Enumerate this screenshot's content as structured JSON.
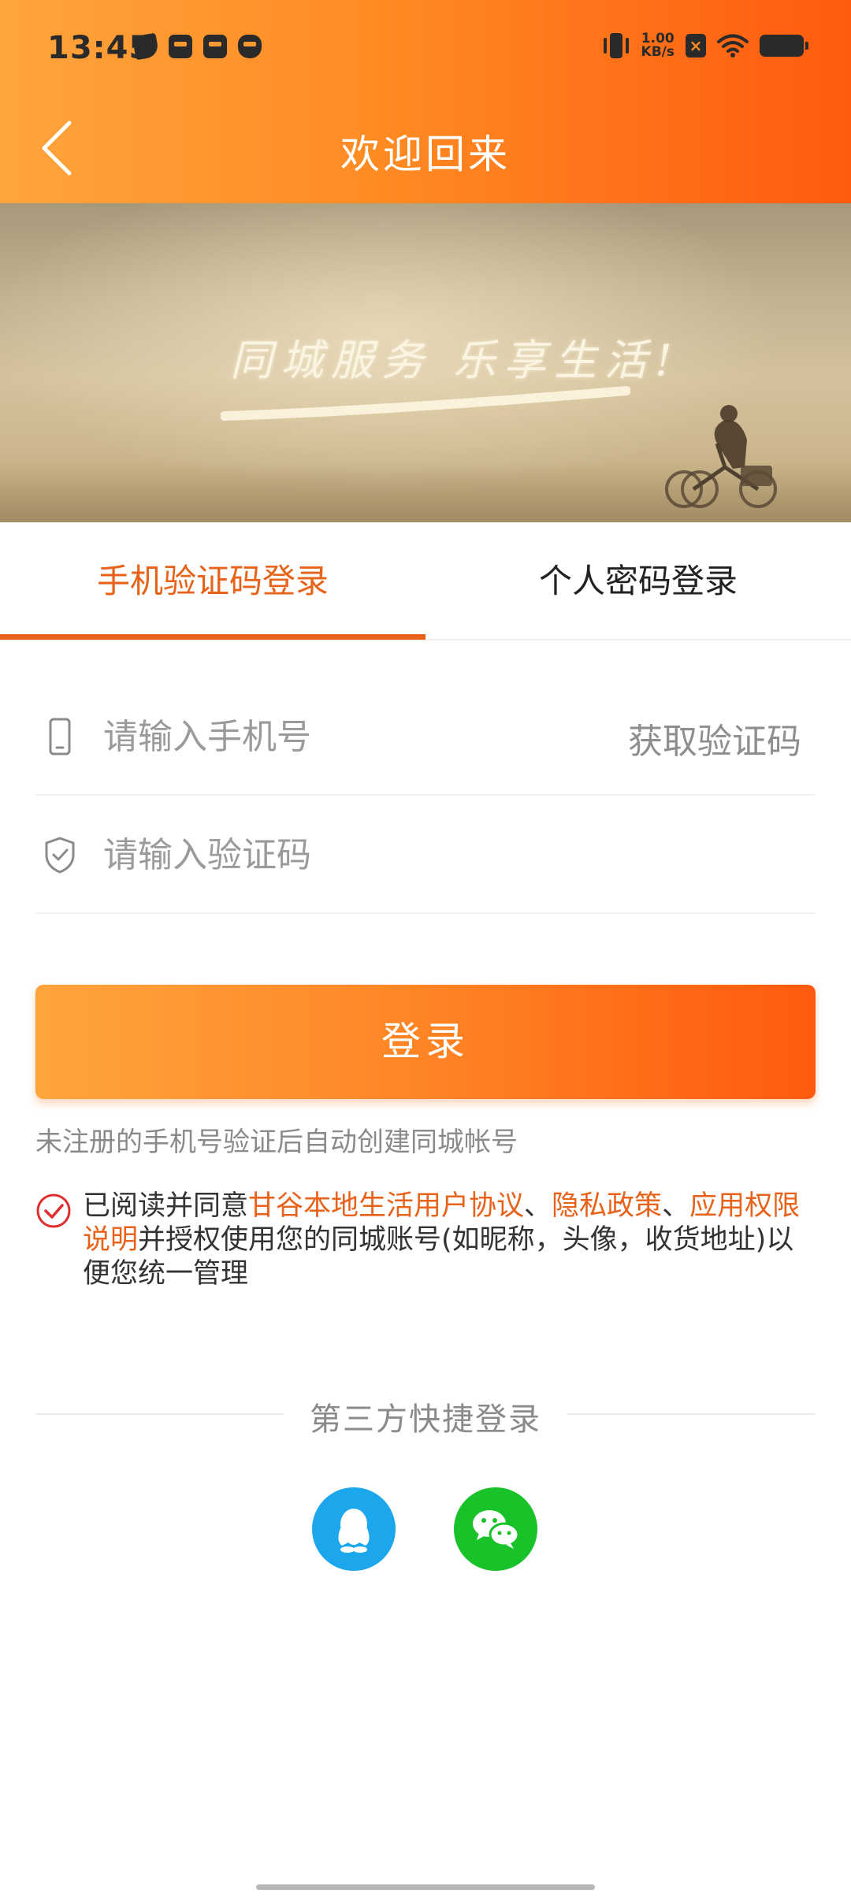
{
  "status_bar": {
    "time": "13:45",
    "net_speed_value": "1.00",
    "net_speed_unit": "KB/s"
  },
  "nav": {
    "title": "欢迎回来"
  },
  "banner": {
    "slogan": "同城服务 乐享生活!"
  },
  "tabs": [
    {
      "label": "手机验证码登录",
      "active": true
    },
    {
      "label": "个人密码登录",
      "active": false
    }
  ],
  "form": {
    "phone_placeholder": "请输入手机号",
    "get_code_label": "获取验证码",
    "code_placeholder": "请输入验证码",
    "login_label": "登录",
    "register_hint": "未注册的手机号验证后自动创建同城帐号"
  },
  "agreement": {
    "prefix": "已阅读并同意",
    "link_user_agreement": "甘谷本地生活用户协议",
    "sep1": "、",
    "link_privacy": "隐私政策",
    "sep2": "、",
    "link_permissions": "应用权限说明",
    "suffix": "并授权使用您的同城账号(如昵称，头像，收货地址)以便您统一管理"
  },
  "third_party": {
    "title": "第三方快捷登录"
  },
  "colors": {
    "accent": "#e8621a",
    "qq": "#1ca7ec",
    "wechat": "#18c228"
  }
}
